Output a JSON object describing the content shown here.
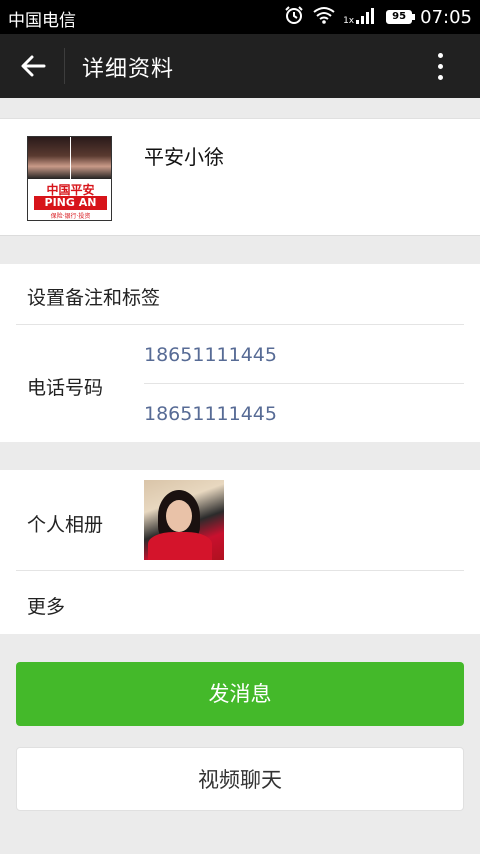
{
  "status_bar": {
    "carrier": "中国电信",
    "network_type": "1x",
    "battery": "95",
    "time": "07:05"
  },
  "header": {
    "title": "详细资料",
    "back_icon": "back-arrow-icon",
    "more_icon": "more-vertical-icon"
  },
  "profile": {
    "nickname": "平安小徐",
    "avatar_logo_cn": "中国平安",
    "avatar_logo_en": "PING AN",
    "avatar_logo_tag": "保险·银行·投资"
  },
  "details": {
    "remark_tags_label": "设置备注和标签",
    "phone_label": "电话号码",
    "phones": [
      "18651111445",
      "18651111445"
    ]
  },
  "album": {
    "label": "个人相册",
    "more_label": "更多"
  },
  "actions": {
    "send_message": "发消息",
    "video_chat": "视频聊天"
  },
  "colors": {
    "primary_green": "#44b92a",
    "link_blue": "#576b95",
    "app_bar": "#212121"
  }
}
